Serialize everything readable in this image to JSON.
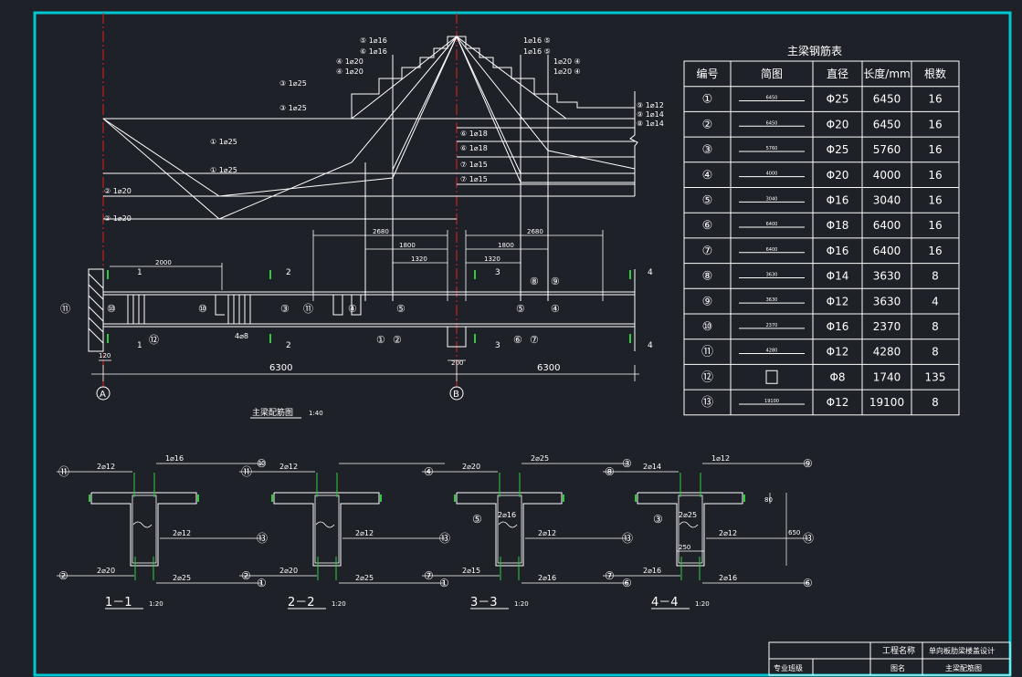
{
  "colors": {
    "background": "#1e2127",
    "frame": "#00c8d2",
    "line": "#ffffff",
    "dim": "#ffffff",
    "axis": "#e0201e",
    "rebar_tick": "#2ecc40"
  },
  "drawing": {
    "main_title": "主梁配筋图",
    "main_scale": "1:40",
    "dim_6300_left": "6300",
    "dim_6300_right": "6300",
    "dim_2000": "2000",
    "dim_2680_left": "2680",
    "dim_2680_right": "2680",
    "dim_1800_left": "1800",
    "dim_1800_right": "1800",
    "dim_1320_left": "1320",
    "dim_1320_right": "1320",
    "dim_120": "120",
    "dim_200": "200",
    "axis_a": "A",
    "axis_b": "B",
    "sec_marks": [
      "1",
      "2",
      "3",
      "4",
      "1",
      "2",
      "3",
      "4"
    ],
    "stirrup_label": "4⌀8",
    "bar_labels_top_left": [
      "⑤ 1⌀16",
      "⑥ 1⌀16",
      "④ 1⌀20",
      "④ 1⌀20",
      "③ 1⌀25",
      "③ 1⌀25"
    ],
    "bar_labels_top_right": [
      "1⌀16 ⑤",
      "1⌀16 ⑤",
      "1⌀20 ④",
      "1⌀20 ④"
    ],
    "bar_labels_mid_left": [
      "① 1⌀25",
      "① 1⌀25",
      "② 1⌀20",
      "② 1⌀20"
    ],
    "bar_labels_mid_right": [
      "⑥ 1⌀18",
      "⑥ 1⌀18",
      "⑦ 1⌀15",
      "⑦ 1⌀15"
    ],
    "bar_labels_far_right": [
      "⑨ 1⌀12",
      "⑨ 1⌀14",
      "⑧ 1⌀14"
    ],
    "beam_circles": [
      "⑪",
      "⑩",
      "⑫",
      "⑩",
      "③",
      "⑪",
      "④",
      "⑤",
      "①",
      "②",
      "⑤",
      "④",
      "⑥",
      "⑦",
      "⑧",
      "⑨"
    ]
  },
  "table": {
    "title": "主梁钢筋表",
    "headers": [
      "编号",
      "简图",
      "直径",
      "长度/mm",
      "根数"
    ],
    "rows": [
      {
        "no": "①",
        "sketch": "6450",
        "dia": "Φ25",
        "len": "6450",
        "count": "16"
      },
      {
        "no": "②",
        "sketch": "6450",
        "dia": "Φ20",
        "len": "6450",
        "count": "16"
      },
      {
        "no": "③",
        "sketch": "5760",
        "dia": "Φ25",
        "len": "5760",
        "count": "16"
      },
      {
        "no": "④",
        "sketch": "4000",
        "dia": "Φ20",
        "len": "4000",
        "count": "16"
      },
      {
        "no": "⑤",
        "sketch": "3040",
        "dia": "Φ16",
        "len": "3040",
        "count": "16"
      },
      {
        "no": "⑥",
        "sketch": "6400",
        "dia": "Φ18",
        "len": "6400",
        "count": "16"
      },
      {
        "no": "⑦",
        "sketch": "6400",
        "dia": "Φ16",
        "len": "6400",
        "count": "16"
      },
      {
        "no": "⑧",
        "sketch": "3630",
        "dia": "Φ14",
        "len": "3630",
        "count": "8"
      },
      {
        "no": "⑨",
        "sketch": "3630",
        "dia": "Φ12",
        "len": "3630",
        "count": "4"
      },
      {
        "no": "⑩",
        "sketch": "2370",
        "dia": "Φ16",
        "len": "2370",
        "count": "8"
      },
      {
        "no": "⑪",
        "sketch": "4280",
        "dia": "Φ12",
        "len": "4280",
        "count": "8"
      },
      {
        "no": "⑫",
        "sketch": "stirrup",
        "dia": "Φ8",
        "len": "1740",
        "count": "135"
      },
      {
        "no": "⑬",
        "sketch": "19100",
        "dia": "Φ12",
        "len": "19100",
        "count": "8"
      }
    ]
  },
  "sections": [
    {
      "title": "1－1",
      "scale": "1:20",
      "top_left": "2⌀12",
      "top_right": "1⌀16",
      "mid": "",
      "side": "2⌀12",
      "bot_left": "2⌀20",
      "bot_right": "2⌀25",
      "c_tl": "⑪",
      "c_tr": "⑩",
      "c_side": "⑬",
      "c_bl": "②",
      "c_br": "①",
      "c_mid": ""
    },
    {
      "title": "2－2",
      "scale": "1:20",
      "top_left": "2⌀12",
      "top_right": "",
      "mid": "",
      "side": "2⌀12",
      "bot_left": "2⌀20",
      "bot_right": "2⌀25",
      "c_tl": "⑪",
      "c_tr": "",
      "c_side": "⑬",
      "c_bl": "②",
      "c_br": "①",
      "c_mid": ""
    },
    {
      "title": "3－3",
      "scale": "1:20",
      "top_left": "2⌀20",
      "top_right": "2⌀25",
      "mid": "2⌀16",
      "side": "2⌀12",
      "bot_left": "2⌀15",
      "bot_right": "2⌀16",
      "c_tl": "④",
      "c_tr": "③",
      "c_side": "⑬",
      "c_bl": "⑦",
      "c_br": "⑥",
      "c_mid": "⑤"
    },
    {
      "title": "4－4",
      "scale": "1:20",
      "top_left": "2⌀14",
      "top_right": "1⌀12",
      "mid": "2⌀25",
      "side": "2⌀12",
      "bot_left": "2⌀16",
      "bot_right": "2⌀16",
      "c_tl": "⑧",
      "c_tr": "⑨",
      "c_side": "⑬",
      "c_bl": "⑦",
      "c_br": "⑥",
      "c_mid": "③",
      "dim_80": "80",
      "dim_650": "650",
      "dim_250": "250"
    }
  ],
  "title_block": {
    "project_label": "工程名称",
    "project_name": "单向板肋梁楼盖设计",
    "major_label": "专业班级",
    "drawing_label": "图名",
    "drawing_name": "主梁配筋图"
  }
}
